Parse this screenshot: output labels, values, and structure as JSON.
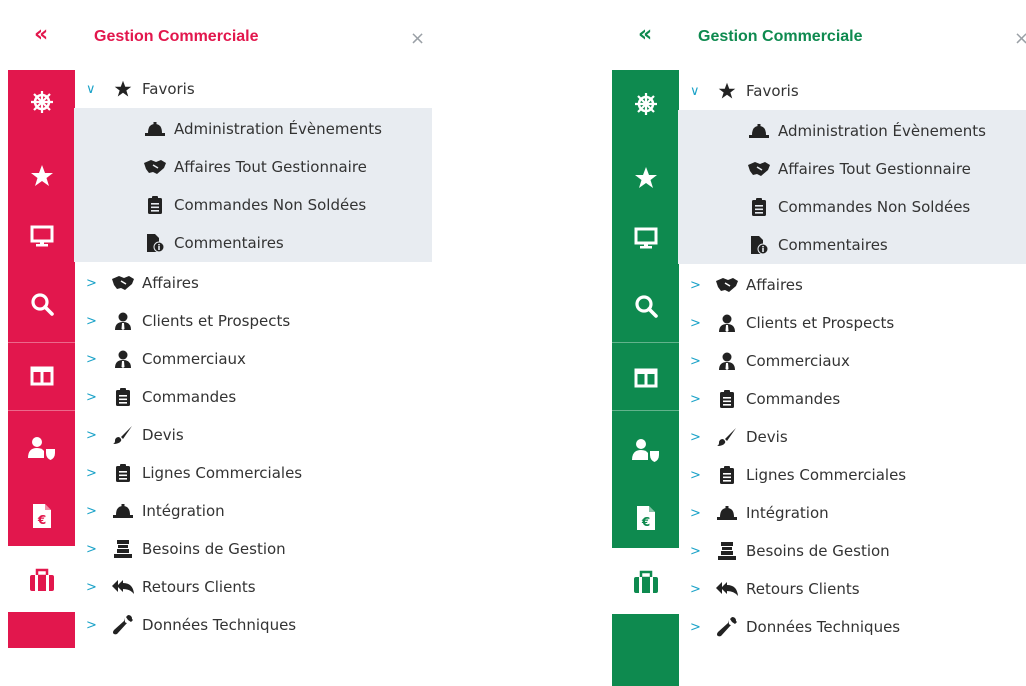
{
  "panels": [
    {
      "id": "left",
      "accent": "#e2174d",
      "header": {
        "collapse_glyph": "«",
        "title": "Gestion Commerciale",
        "close_glyph": "×"
      }
    },
    {
      "id": "right",
      "accent": "#0e8a4f",
      "header": {
        "collapse_glyph": "«",
        "title": "Gestion Commerciale",
        "close_glyph": "×"
      }
    }
  ],
  "rail_icons": [
    "helm-icon",
    "star-icon",
    "monitor-icon",
    "search-icon",
    "columns-icon",
    "user-shield-icon",
    "euro-document-icon",
    "briefcase-icon"
  ],
  "tree": {
    "favoris": {
      "label": "Favoris",
      "expanded": true,
      "children": [
        {
          "label": "Administration Évènements",
          "icon": "hardhat-icon"
        },
        {
          "label": "Affaires Tout Gestionnaire",
          "icon": "handshake-icon"
        },
        {
          "label": "Commandes Non Soldées",
          "icon": "clipboard-icon"
        },
        {
          "label": "Commentaires",
          "icon": "file-info-icon"
        }
      ]
    },
    "items": [
      {
        "label": "Affaires",
        "icon": "handshake-icon"
      },
      {
        "label": "Clients et Prospects",
        "icon": "user-tie-icon"
      },
      {
        "label": "Commerciaux",
        "icon": "user-tie-icon"
      },
      {
        "label": "Commandes",
        "icon": "clipboard-icon"
      },
      {
        "label": "Devis",
        "icon": "brush-icon"
      },
      {
        "label": "Lignes Commerciales",
        "icon": "clipboard-icon"
      },
      {
        "label": "Intégration",
        "icon": "hardhat-icon"
      },
      {
        "label": "Besoins de Gestion",
        "icon": "archive-icon"
      },
      {
        "label": "Retours Clients",
        "icon": "reply-all-icon"
      },
      {
        "label": "Données Techniques",
        "icon": "wrench-icon"
      }
    ]
  }
}
